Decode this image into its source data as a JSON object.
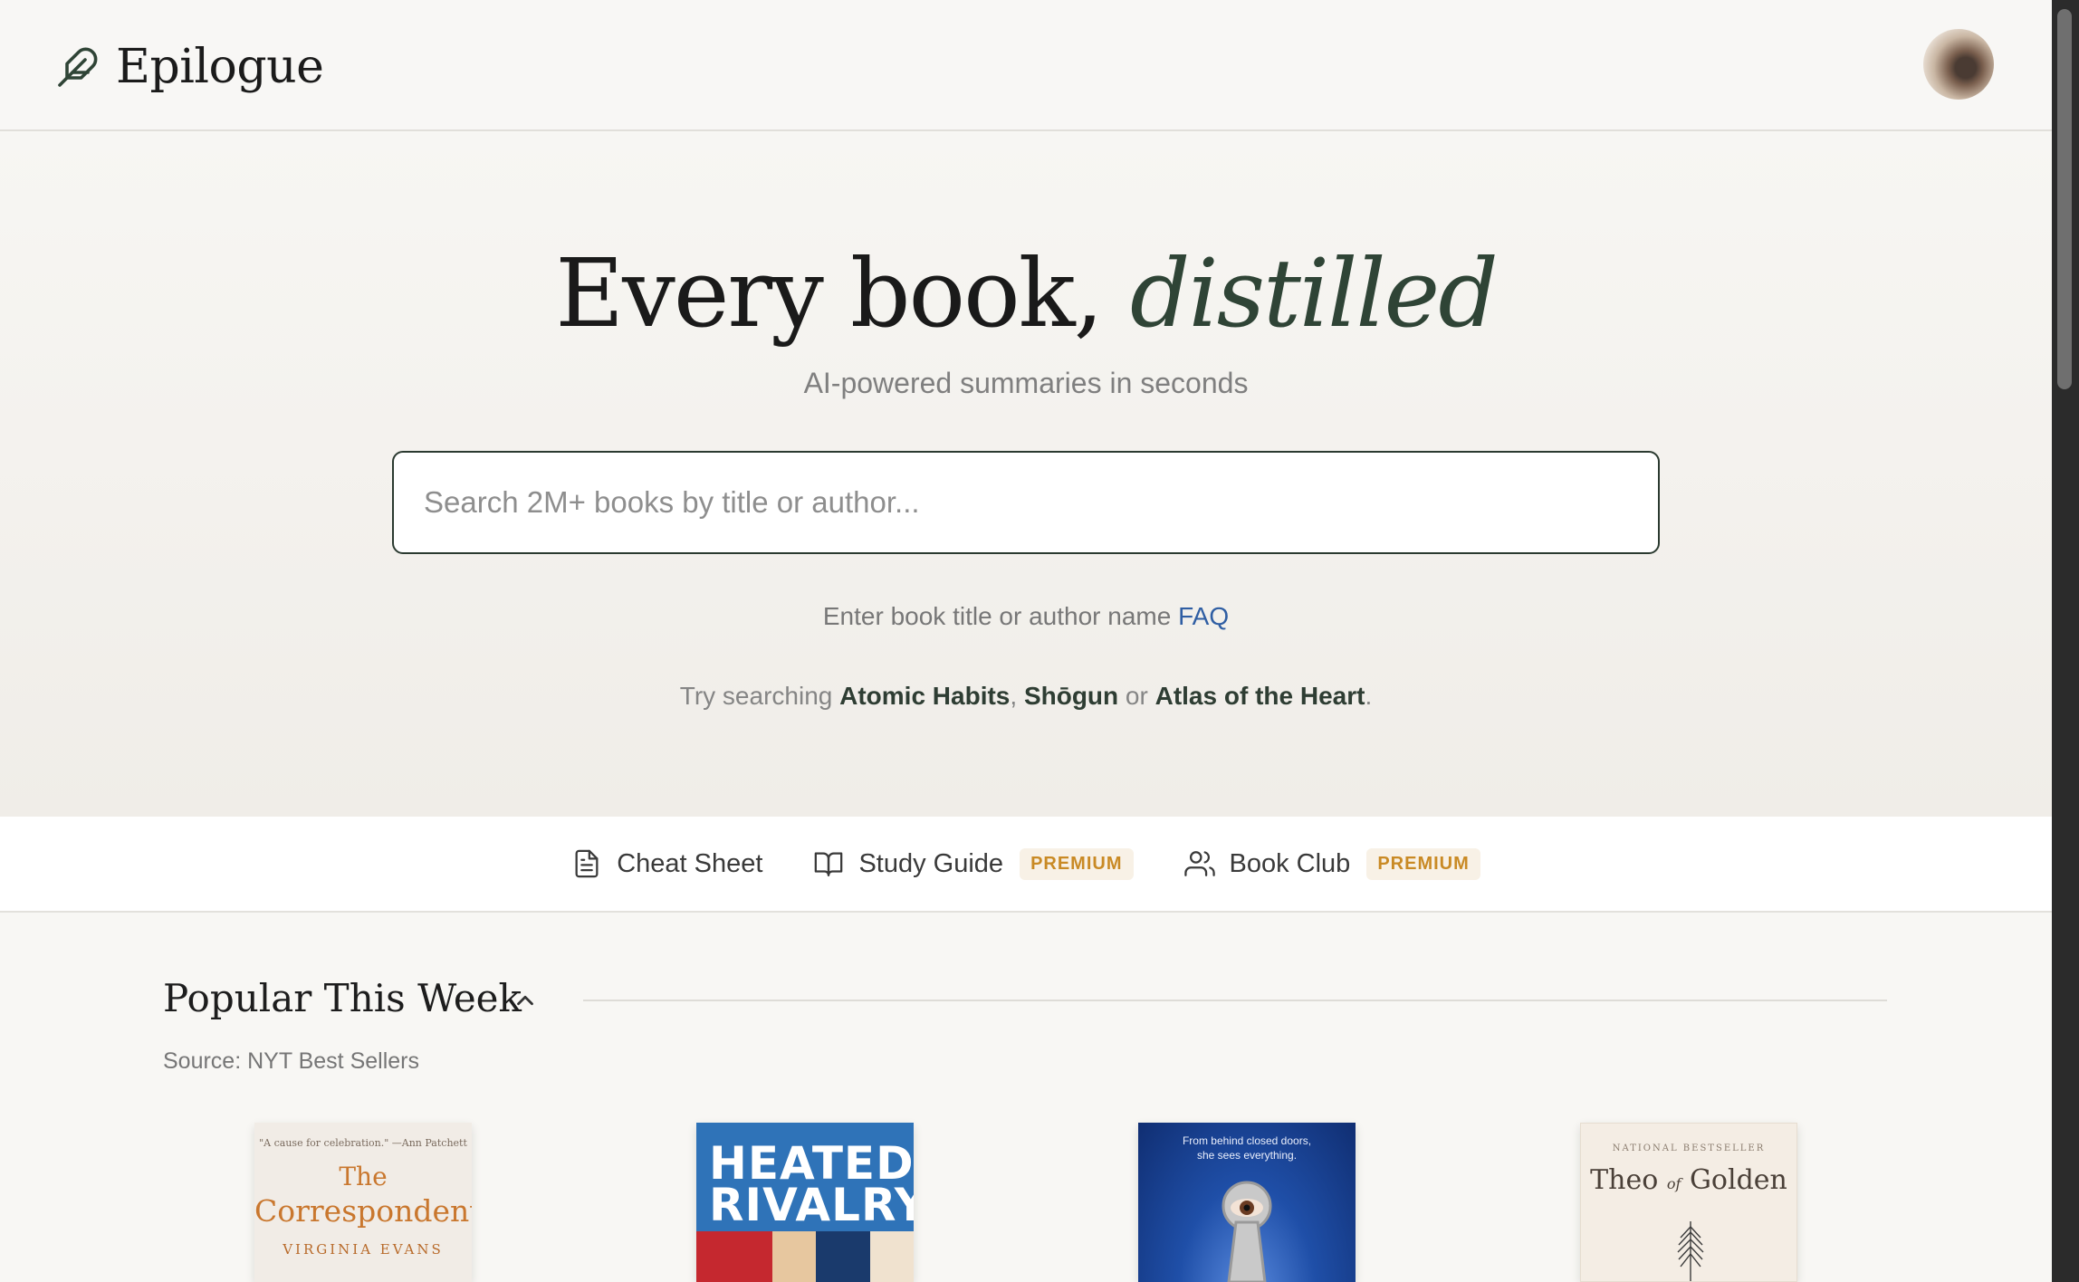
{
  "header": {
    "brand": "Epilogue",
    "logo_icon": "feather-icon",
    "avatar_icon": "user-avatar"
  },
  "hero": {
    "title_main": "Every book, ",
    "title_accent": "distilled",
    "subtitle": "AI-powered summaries in seconds",
    "search_placeholder": "Search 2M+ books by title or author...",
    "hint_text": "Enter book title or author name",
    "hint_link": "FAQ",
    "try_prefix": "Try searching",
    "try_1": "Atomic Habits",
    "try_sep1": ",",
    "try_2": "Shōgun",
    "try_sep2": "or",
    "try_3": "Atlas of the Heart",
    "try_end": "."
  },
  "features": [
    {
      "label": "Cheat Sheet",
      "icon": "document-icon",
      "badge": ""
    },
    {
      "label": "Study Guide",
      "icon": "open-book-icon",
      "badge": "PREMIUM"
    },
    {
      "label": "Book Club",
      "icon": "users-icon",
      "badge": "PREMIUM"
    }
  ],
  "popular": {
    "title": "Popular This Week",
    "source": "Source: NYT Best Sellers",
    "books": [
      {
        "quote": "\"A cause for celebration.\" —Ann Patchett",
        "title_1": "The",
        "title_2": "Correspondent",
        "author": "VIRGINIA EVANS"
      },
      {
        "title_1": "HEATED",
        "title_2": "RIVALRY"
      },
      {
        "tagline_1": "From behind closed doors,",
        "tagline_2": "she sees everything."
      },
      {
        "tag": "NATIONAL BESTSELLER",
        "title_1": "Theo",
        "title_of": "of",
        "title_2": "Golden"
      }
    ]
  },
  "colors": {
    "accent": "#2f4436",
    "link": "#2f5ea3",
    "premium": "#c98a25"
  }
}
